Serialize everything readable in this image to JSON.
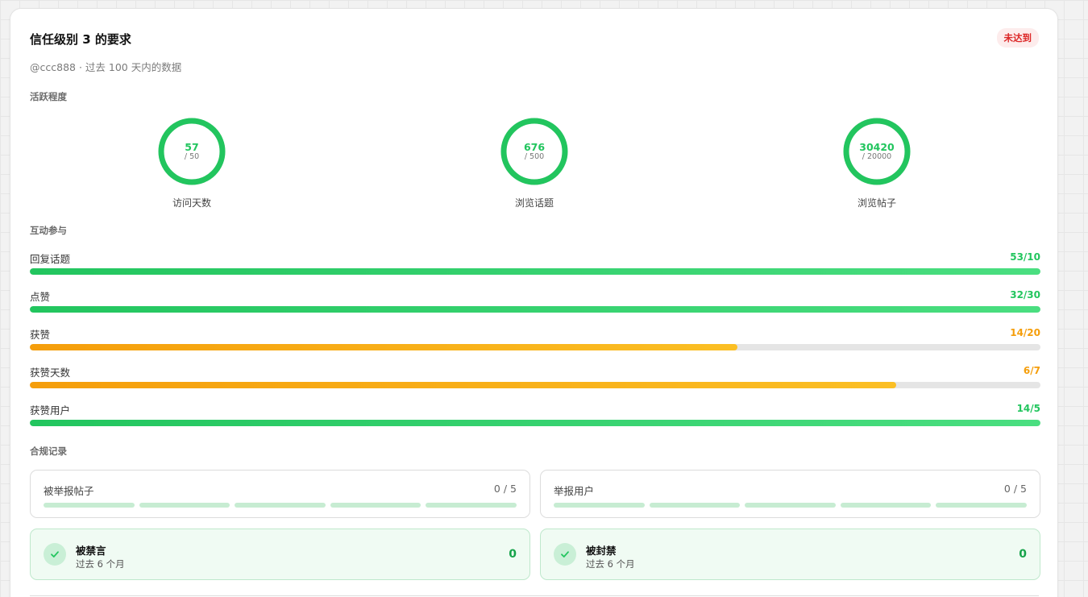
{
  "header": {
    "title": "信任级别 3 的要求",
    "status_badge": "未达到",
    "subtitle": "@ccc888 · 过去 100 天内的数据"
  },
  "sections": {
    "activity": "活跃程度",
    "engagement": "互动参与",
    "compliance": "合规记录"
  },
  "activity_rings": [
    {
      "value": "57",
      "target": "/ 50",
      "label": "访问天数",
      "progress": 1.0
    },
    {
      "value": "676",
      "target": "/ 500",
      "label": "浏览话题",
      "progress": 1.0
    },
    {
      "value": "30420",
      "target": "/ 20000",
      "label": "浏览帖子",
      "progress": 1.0
    }
  ],
  "engagement_bars": [
    {
      "label": "回复话题",
      "value": "53/10",
      "progress": 1.0,
      "status": "met"
    },
    {
      "label": "点赞",
      "value": "32/30",
      "progress": 1.0,
      "status": "met"
    },
    {
      "label": "获赞",
      "value": "14/20",
      "progress": 0.7,
      "status": "unmet"
    },
    {
      "label": "获赞天数",
      "value": "6/7",
      "progress": 0.857,
      "status": "unmet"
    },
    {
      "label": "获赞用户",
      "value": "14/5",
      "progress": 1.0,
      "status": "met"
    }
  ],
  "reports": [
    {
      "label": "被举报帖子",
      "value": "0 / 5",
      "segments": 5
    },
    {
      "label": "举报用户",
      "value": "0 / 5",
      "segments": 5
    }
  ],
  "penalties": [
    {
      "label": "被禁言",
      "period": "过去 6 个月",
      "value": "0"
    },
    {
      "label": "被封禁",
      "period": "过去 6 个月",
      "value": "0"
    }
  ],
  "colors": {
    "met": "#22c55e",
    "unmet": "#f59e0b",
    "badge_text": "#dc2626",
    "badge_bg": "#fdecec"
  },
  "icons": {
    "penalty_status": "check-icon"
  }
}
